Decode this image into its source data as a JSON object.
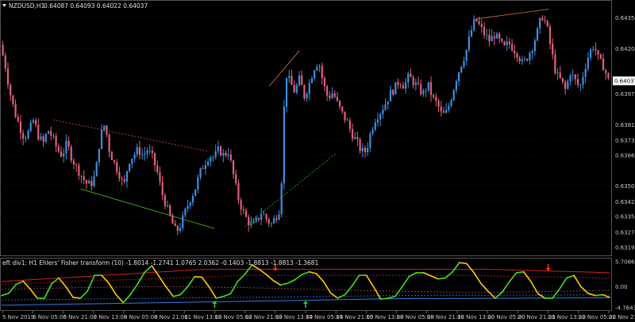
{
  "header": {
    "symbol": "NZDUSD,H1",
    "ohlc": "0.64087 0.64093 0.64022 0.64037"
  },
  "indicator": {
    "label": "eft div1: H1 Ehlers' Fisher transform (10) -1.8014 -1.2741 1.0765 2.0362 -0.1403 -1.8813 -1.8813 -1.3681"
  },
  "colors": {
    "background": "#000000",
    "bull_candle": "#3d8fe0",
    "bear_candle": "#e0607a",
    "grid": "#1a1a3a",
    "price_tag": "#ffffff",
    "fisher_up": "#44dd22",
    "fisher_down": "#ffcc00",
    "band_upper": "#d02020",
    "band_lower": "#2a7de0",
    "divergence_bear": "#ff3020",
    "divergence_bull": "#33cc33"
  },
  "chart_data": [
    {
      "type": "candlestick",
      "title": "NZDUSD,H1",
      "current_price": 0.64037,
      "y_ticks": [
        0.64355,
        0.642,
        0.64037,
        0.6397,
        0.63815,
        0.63735,
        0.6366,
        0.63505,
        0.63425,
        0.6335,
        0.6327,
        0.63195
      ],
      "ylim": [
        0.6317,
        0.6443
      ],
      "x_ticks": [
        "5 Nov 2019",
        "6 Nov 05:00",
        "6 Nov 21:00",
        "7 Nov 13:00",
        "8 Nov 05:00",
        "8 Nov 21:00",
        "11 Nov 13:00",
        "12 Nov 05:00",
        "12 Nov 21:00",
        "13 Nov 13:00",
        "14 Nov 05:00",
        "14 Nov 21:00",
        "15 Nov 13:00",
        "18 Nov 05:00",
        "18 Nov 21:00",
        "19 Nov 13:00",
        "20 Nov 05:00",
        "20 Nov 21:00",
        "21 Nov 13:00",
        "22 Nov 05:00",
        "22 Nov 21:00"
      ],
      "close_path": [
        0.6422,
        0.6412,
        0.6398,
        0.6388,
        0.6381,
        0.6375,
        0.6378,
        0.6384,
        0.6376,
        0.6372,
        0.6379,
        0.6375,
        0.6369,
        0.6366,
        0.6372,
        0.6365,
        0.636,
        0.6356,
        0.6352,
        0.6351,
        0.6356,
        0.6375,
        0.6382,
        0.6368,
        0.6362,
        0.6357,
        0.635,
        0.6363,
        0.6366,
        0.6369,
        0.6366,
        0.6369,
        0.6365,
        0.6358,
        0.6347,
        0.634,
        0.6333,
        0.6327,
        0.6331,
        0.6338,
        0.6344,
        0.6349,
        0.6357,
        0.6362,
        0.6366,
        0.6365,
        0.6369,
        0.6366,
        0.6368,
        0.6357,
        0.6345,
        0.6338,
        0.6333,
        0.633,
        0.6333,
        0.6337,
        0.6334,
        0.6331,
        0.6335,
        0.634,
        0.6408,
        0.6403,
        0.6398,
        0.6405,
        0.6396,
        0.6402,
        0.641,
        0.6414,
        0.6402,
        0.6395,
        0.6398,
        0.6392,
        0.6387,
        0.6383,
        0.6377,
        0.6373,
        0.6368,
        0.6368,
        0.6378,
        0.6385,
        0.6388,
        0.6392,
        0.6397,
        0.64,
        0.6404,
        0.6401,
        0.6406,
        0.6403,
        0.64,
        0.6397,
        0.6402,
        0.6395,
        0.6392,
        0.6386,
        0.6388,
        0.6396,
        0.6405,
        0.6412,
        0.6418,
        0.6428,
        0.6435,
        0.6431,
        0.6427,
        0.6424,
        0.6427,
        0.6424,
        0.642,
        0.6423,
        0.642,
        0.6417,
        0.6412,
        0.6416,
        0.6421,
        0.6428,
        0.6437,
        0.6432,
        0.6419,
        0.6407,
        0.6404,
        0.6399,
        0.6408,
        0.6404,
        0.64,
        0.641,
        0.6418,
        0.6422,
        0.6414,
        0.6411,
        0.6404
      ]
    },
    {
      "type": "line",
      "title": "",
      "ylim": [
        -4.7643,
        5.7086
      ],
      "y_ticks": [
        5.7086,
        0.0,
        -4.7643
      ],
      "series": [
        {
          "values": [
            -2.0,
            -1.5,
            0.5,
            1.3,
            -0.5,
            -2.6,
            -2.6,
            0.7,
            2.0,
            0.0,
            -2.4,
            -2.6,
            -1.0,
            2.6,
            2.6,
            0.8,
            -1.8,
            -3.6,
            -1.8,
            0.6,
            3.3,
            4.8,
            2.4,
            0.0,
            -2.2,
            -1.8,
            0.0,
            2.3,
            2.2,
            0.0,
            -2.6,
            -2.2,
            -1.6,
            1.2,
            2.8,
            5.0,
            4.0,
            2.8,
            1.4,
            0.4,
            0.8,
            1.6,
            2.8,
            3.4,
            3.0,
            1.2,
            -1.4,
            -2.6,
            -1.8,
            0.2,
            2.6,
            2.6,
            0.0,
            -2.8,
            -2.6,
            -2.2,
            0.0,
            2.4,
            3.2,
            3.2,
            2.5,
            1.8,
            2.0,
            3.3,
            5.5,
            5.3,
            3.3,
            0.8,
            -1.0,
            -2.6,
            -1.2,
            1.2,
            3.2,
            3.4,
            1.2,
            -1.6,
            -2.6,
            -2.6,
            -0.5,
            2.0,
            2.6,
            0.0,
            -1.5,
            -2.0,
            -1.8,
            -2.4
          ]
        }
      ],
      "divergence_markers": [
        {
          "type": "bearish",
          "x": "13 Nov 13:00"
        },
        {
          "type": "bearish",
          "x": "21 Nov 13:00"
        },
        {
          "type": "bullish",
          "x": "12 Nov 05:00"
        },
        {
          "type": "bullish",
          "x": "14 Nov 05:00"
        }
      ]
    }
  ]
}
